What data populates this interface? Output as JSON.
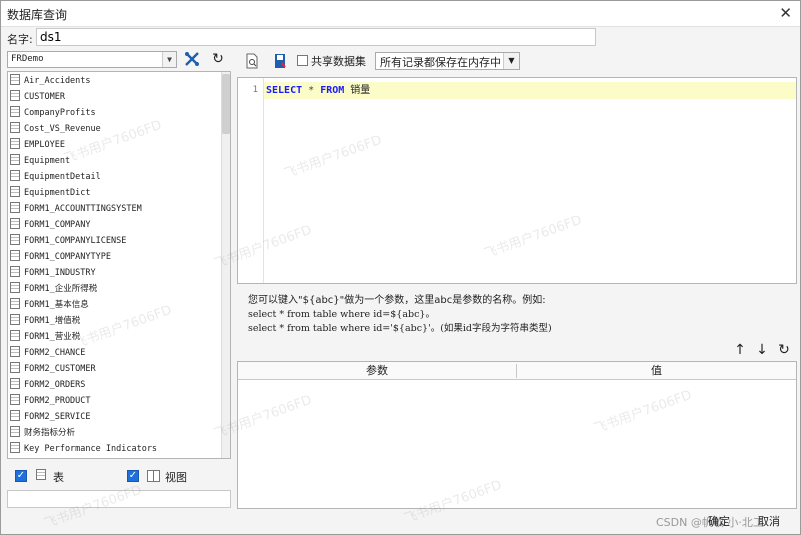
{
  "window": {
    "title": "数据库查询",
    "close_icon": "✕"
  },
  "name_field": {
    "label": "名字:",
    "value": "ds1"
  },
  "left": {
    "connection": "FRDemo",
    "tables": [
      "Air_Accidents",
      "CUSTOMER",
      "CompanyProfits",
      "Cost_VS_Revenue",
      "EMPLOYEE",
      "Equipment",
      "EquipmentDetail",
      "EquipmentDict",
      "FORM1_ACCOUNTTINGSYSTEM",
      "FORM1_COMPANY",
      "FORM1_COMPANYLICENSE",
      "FORM1_COMPANYTYPE",
      "FORM1_INDUSTRY",
      "FORM1_企业所得税",
      "FORM1_基本信息",
      "FORM1_增值税",
      "FORM1_营业税",
      "FORM2_CHANCE",
      "FORM2_CUSTOMER",
      "FORM2_ORDERS",
      "FORM2_PRODUCT",
      "FORM2_SERVICE",
      "财务指标分析",
      "Key Performance Indicators"
    ],
    "show_tables_label": "表",
    "show_views_label": "视图"
  },
  "right": {
    "share_label": "共享数据集",
    "memory_option": "所有记录都保存在内存中",
    "editor": {
      "line_number": "1",
      "kw_select": "SELECT",
      "star": " * ",
      "kw_from": "FROM",
      "table_name": " 销量"
    },
    "hint": {
      "line1": "您可以键入\"${abc}\"做为一个参数，这里abc是参数的名称。例如:",
      "line2": "select * from table where id=${abc}。",
      "line3": "select * from table where id='${abc}'。(如果id字段为字符串类型)"
    },
    "param_table": {
      "col_param": "参数",
      "col_value": "值"
    }
  },
  "footer": {
    "ok": "确定",
    "cancel": "取消",
    "watermark": "CSDN @帆软·小·北工"
  },
  "watermark_text": "飞书用户7606FD"
}
